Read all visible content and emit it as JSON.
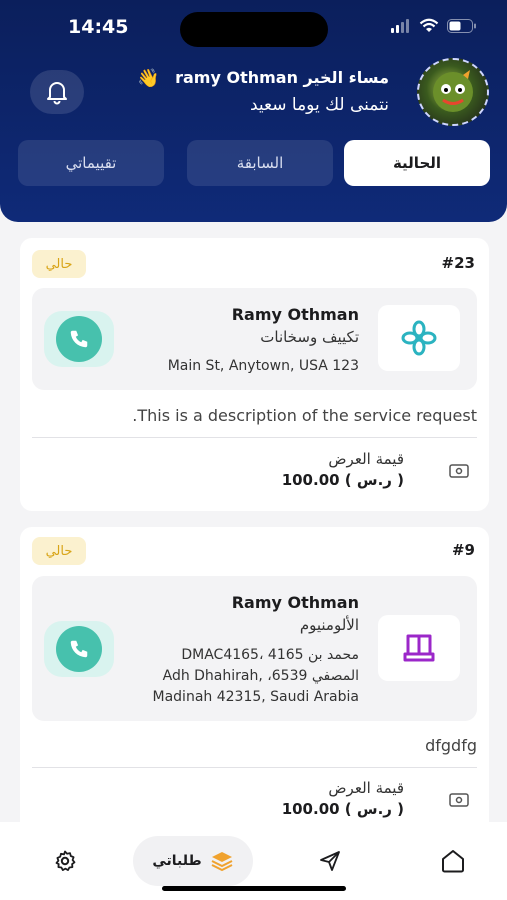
{
  "status": {
    "time": "14:45"
  },
  "header": {
    "greeting": "مساء الخير ramy Othman",
    "subtitle": "نتمنى لك يوما سعيد"
  },
  "tabs": [
    {
      "label": "الحالية",
      "active": true
    },
    {
      "label": "السابقة",
      "active": false
    },
    {
      "label": "تقييماتي",
      "active": false
    }
  ],
  "orders": [
    {
      "number": "#23",
      "badge": "حالي",
      "customer": "Ramy Othman",
      "service": "تكييف وسخانات",
      "address_lines": [
        "Main St, Anytown, USA 123"
      ],
      "description": ".This is a description of the service request",
      "offer_label": "قيمة العرض",
      "offer_value": "100.00 ( ر.س )",
      "service_icon": "fan-icon"
    },
    {
      "number": "#9",
      "badge": "حالي",
      "customer": "Ramy Othman",
      "service": "الألومنيوم",
      "address_lines": [
        "DMAC4165، 4165 محمد بن",
        "Adh Dhahirah, ،6539 المصفي",
        "Madinah 42315, Saudi Arabia"
      ],
      "description": "dfgdfg",
      "offer_label": "قيمة العرض",
      "offer_value": "100.00 ( ر.س )",
      "service_icon": "window-frame-icon"
    }
  ],
  "nav": {
    "active_label": "طلباتي",
    "items": [
      "gear-icon",
      "layers-icon",
      "send-icon",
      "home-icon"
    ]
  },
  "colors": {
    "header": "#0f2a78",
    "accent_orange": "#f0a22e",
    "call": "#47c1ad",
    "badge_text": "#d8a417",
    "purple": "#9b27c9",
    "teal": "#2bb3c0"
  }
}
